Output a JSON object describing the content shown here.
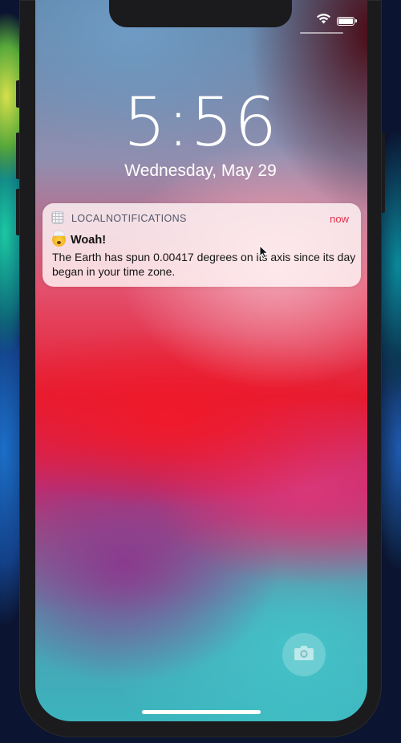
{
  "lock_screen": {
    "time": "5:56",
    "date": "Wednesday, May 29"
  },
  "status_bar": {
    "icons": [
      "wifi-icon",
      "battery-icon"
    ]
  },
  "notification": {
    "app_icon": "grid-app-icon",
    "app_name": "LOCALNOTIFICATIONS",
    "time": "now",
    "emoji": "exploding-head-emoji",
    "title": "Woah!",
    "body": "The Earth has spun 0.00417 degrees on its axis since its day began in your time zone."
  },
  "controls": {
    "camera_icon": "camera-icon"
  },
  "colors": {
    "notification_time": "#e3304a",
    "notification_bg": "#fff6f6"
  }
}
